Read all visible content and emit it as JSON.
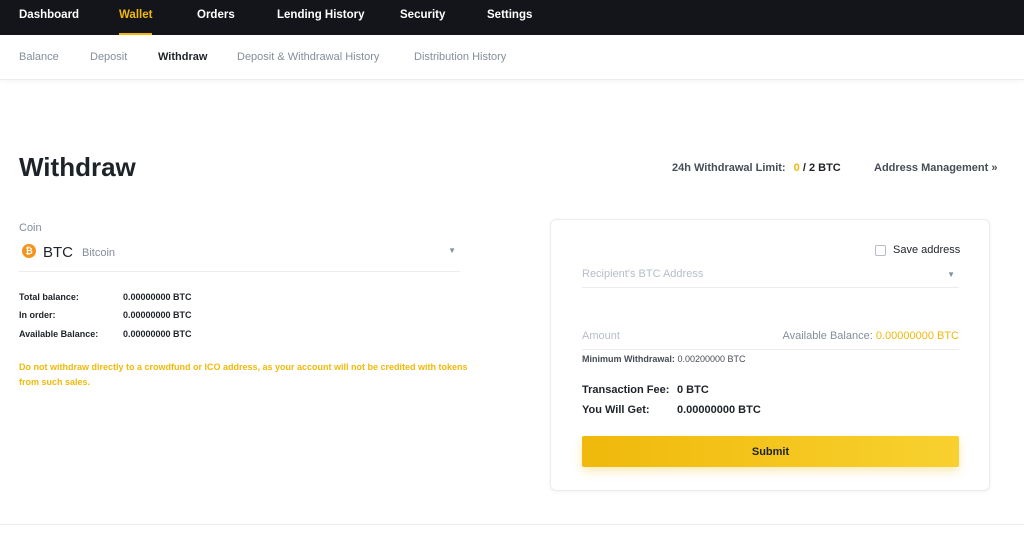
{
  "topnav": {
    "items": [
      {
        "label": "Dashboard"
      },
      {
        "label": "Wallet"
      },
      {
        "label": "Orders"
      },
      {
        "label": "Lending History"
      },
      {
        "label": "Security"
      },
      {
        "label": "Settings"
      }
    ],
    "active": "Wallet"
  },
  "subnav": {
    "items": [
      {
        "label": "Balance"
      },
      {
        "label": "Deposit"
      },
      {
        "label": "Withdraw"
      },
      {
        "label": "Deposit & Withdrawal History"
      },
      {
        "label": "Distribution History"
      }
    ],
    "active": "Withdraw"
  },
  "header": {
    "title": "Withdraw",
    "limit_label": "24h Withdrawal Limit:",
    "limit_used": "0",
    "limit_sep": "/",
    "limit_total": "2 BTC",
    "address_management": "Address Management »"
  },
  "coin": {
    "label": "Coin",
    "symbol": "BTC",
    "name": "Bitcoin",
    "icon": "bitcoin-icon",
    "icon_glyph": "₿"
  },
  "balances": [
    {
      "label": "Total balance:",
      "value": "0.00000000 BTC"
    },
    {
      "label": "In order:",
      "value": "0.00000000 BTC"
    },
    {
      "label": "Available Balance:",
      "value": "0.00000000 BTC"
    }
  ],
  "warning": "Do not withdraw directly to a crowdfund or ICO address, as your account will not be credited with tokens from such sales.",
  "form": {
    "save_address_label": "Save address",
    "save_address_checked": false,
    "address_placeholder": "Recipient's BTC Address",
    "address_value": "",
    "amount_placeholder": "Amount",
    "amount_value": "",
    "available_label": "Available Balance:",
    "available_value": "0.00000000 BTC",
    "min_withdrawal_label": "Minimum Withdrawal:",
    "min_withdrawal_value": "0.00200000 BTC",
    "fee_label": "Transaction Fee:",
    "fee_value": "0 BTC",
    "get_label": "You Will Get:",
    "get_value": "0.00000000 BTC",
    "submit_label": "Submit"
  },
  "colors": {
    "accent": "#f0b90b",
    "topnav_bg": "#14151a",
    "bitcoin": "#f7931a"
  }
}
